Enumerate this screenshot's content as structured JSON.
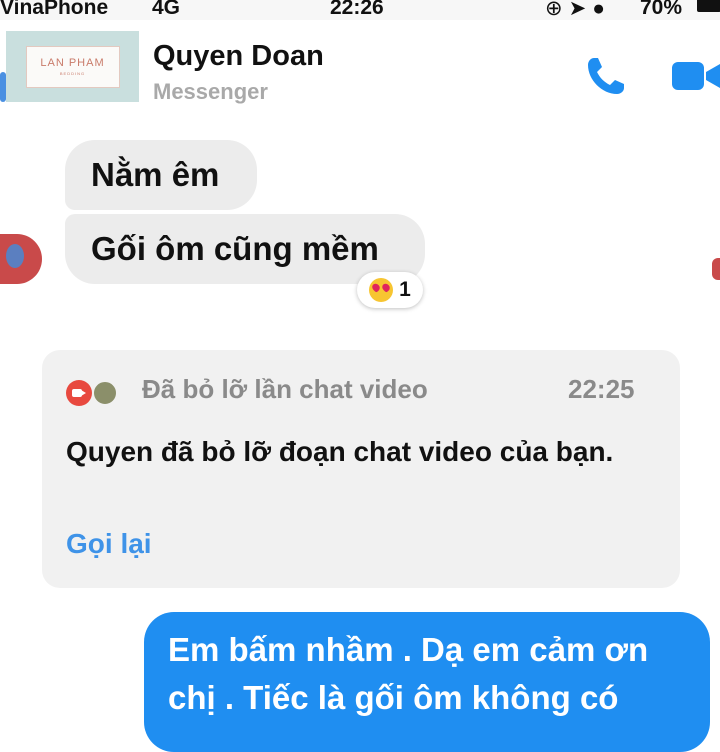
{
  "status_bar": {
    "carrier": "VinaPhone",
    "network": "4G",
    "time": "22:26",
    "battery": "70%"
  },
  "header": {
    "contact_name": "Quyen Doan",
    "subtitle": "Messenger"
  },
  "watermark": {
    "brand": "LAN PHAM",
    "sub": "BEDDING"
  },
  "messages_received": [
    {
      "text": "Nằm êm"
    },
    {
      "text": "Gối ôm cũng mềm"
    }
  ],
  "reaction": {
    "emoji": "heart-eyes-emoji",
    "count": "1"
  },
  "missed_call": {
    "title": "Đã bỏ lỡ lần chat video",
    "time": "22:25",
    "body": "Quyen đã bỏ lỡ đoạn chat video của bạn.",
    "action": "Gọi lại"
  },
  "message_sent": {
    "text": "Em bấm nhầm . Dạ em cảm ơn chị . Tiếc là gối ôm không có"
  },
  "colors": {
    "accent": "#1f8ef1",
    "received_bubble": "#ececec",
    "link": "#3f93e8"
  }
}
